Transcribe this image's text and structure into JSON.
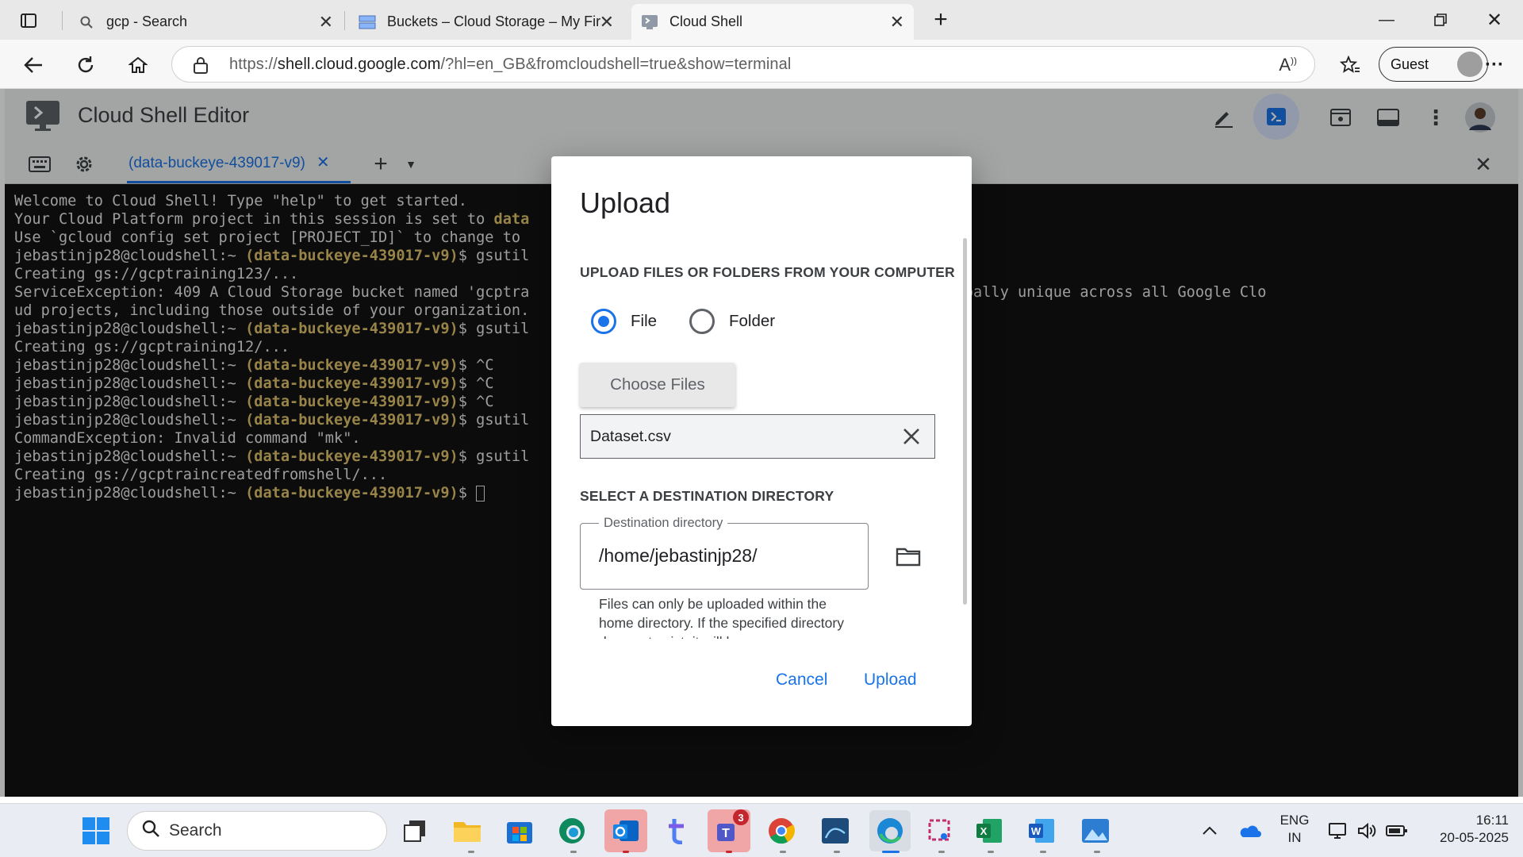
{
  "browser": {
    "tabs": [
      {
        "title": "gcp - Search",
        "icon": "search-icon"
      },
      {
        "title": "Buckets – Cloud Storage – My First Project",
        "icon": "storage-icon"
      },
      {
        "title": "Cloud Shell",
        "icon": "cloud-shell-icon"
      }
    ],
    "url_prefix": "https://",
    "url_domain": "shell.cloud.google.com",
    "url_rest": "/?hl=en_GB&fromcloudshell=true&show=terminal",
    "profile_label": "Guest"
  },
  "app": {
    "title": "Cloud Shell Editor",
    "terminal_tab": "(data-buckeye-439017-v9)"
  },
  "terminal": {
    "lines": [
      {
        "plain": "Welcome to Cloud Shell! Type \"help\" to get started."
      },
      {
        "plain": "Your Cloud Platform project in this session is set to ",
        "proj": "data"
      },
      {
        "plain": "Use `gcloud config set project [PROJECT_ID]` to change to"
      },
      {
        "prompt": "jebastinjp28@cloudshell:~ ",
        "proj": "(data-buckeye-439017-v9)",
        "rest": "$ gsutil"
      },
      {
        "plain": "Creating gs://gcptraining123/..."
      },
      {
        "plain": "ServiceException: 409 A Cloud Storage bucket named 'gcptra",
        "rest": "                          ucket names must be globally unique across all Google Clo"
      },
      {
        "plain": "ud projects, including those outside of your organization."
      },
      {
        "prompt": "jebastinjp28@cloudshell:~ ",
        "proj": "(data-buckeye-439017-v9)",
        "rest": "$ gsutil"
      },
      {
        "plain": "Creating gs://gcptraining12/..."
      },
      {
        "prompt": "jebastinjp28@cloudshell:~ ",
        "proj": "(data-buckeye-439017-v9)",
        "rest": "$ ^C"
      },
      {
        "prompt": "jebastinjp28@cloudshell:~ ",
        "proj": "(data-buckeye-439017-v9)",
        "rest": "$ ^C"
      },
      {
        "prompt": "jebastinjp28@cloudshell:~ ",
        "proj": "(data-buckeye-439017-v9)",
        "rest": "$ ^C"
      },
      {
        "prompt": "jebastinjp28@cloudshell:~ ",
        "proj": "(data-buckeye-439017-v9)",
        "rest": "$ gsutil"
      },
      {
        "plain": "CommandException: Invalid command \"mk\"."
      },
      {
        "prompt": "jebastinjp28@cloudshell:~ ",
        "proj": "(data-buckeye-439017-v9)",
        "rest": "$ gsutil"
      },
      {
        "plain": "Creating gs://gcptraincreatedfromshell/..."
      },
      {
        "prompt": "jebastinjp28@cloudshell:~ ",
        "proj": "(data-buckeye-439017-v9)",
        "rest": "$ ",
        "cursor": true
      }
    ]
  },
  "dialog": {
    "title": "Upload",
    "section_upload": "UPLOAD FILES OR FOLDERS FROM YOUR COMPUTER",
    "radio_file": "File",
    "radio_folder": "Folder",
    "selected": "File",
    "choose_files": "Choose Files",
    "file_name": "Dataset.csv",
    "section_dest": "SELECT A DESTINATION DIRECTORY",
    "dest_label": "Destination directory",
    "dest_value": "/home/jebastinjp28/",
    "helper": "Files can only be uploaded within the home directory. If the specified directory does not exist, it will be",
    "cancel": "Cancel",
    "upload": "Upload"
  },
  "taskbar": {
    "search_placeholder": "Search",
    "teams_badge": "3",
    "lang_1": "ENG",
    "lang_2": "IN",
    "time": "16:11",
    "date": "20-05-2025"
  },
  "colors": {
    "accent": "#1a73e8",
    "project_text": "#e0c36b",
    "terminal_bg": "#121212"
  }
}
